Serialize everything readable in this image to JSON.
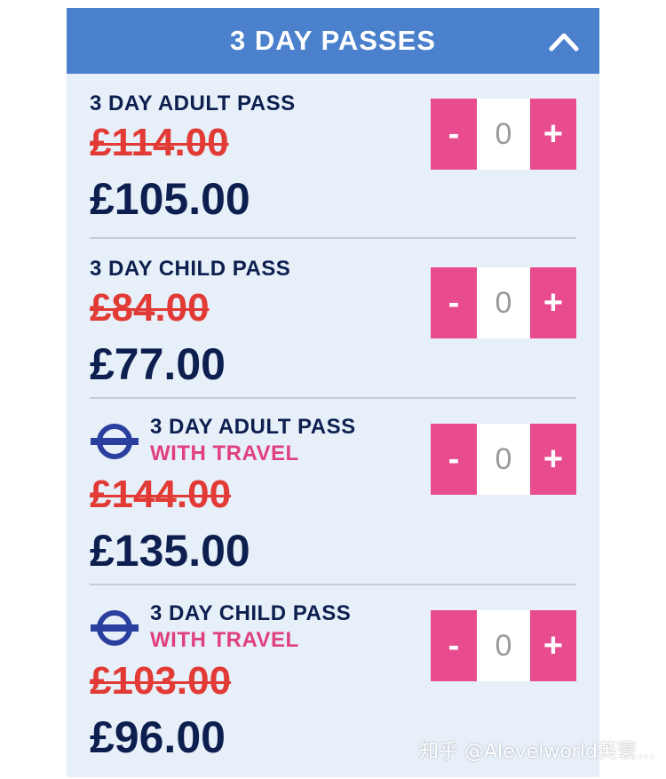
{
  "header": {
    "title": "3 DAY PASSES",
    "collapse_icon": "chevron-up-icon"
  },
  "colors": {
    "header_bg": "#4a80cc",
    "panel_bg": "#e7eff9",
    "stepper_pink": "#e94b8f",
    "old_price_red": "#e23a35",
    "navy": "#0d1f4f",
    "travel_pink": "#e0407f",
    "roundel_blue": "#2a3f9e"
  },
  "items": [
    {
      "title": "3 DAY ADULT PASS",
      "old_price": "£114.00",
      "new_price": "£105.00",
      "minus": "-",
      "quantity": "0",
      "plus": "+"
    },
    {
      "title": "3 DAY CHILD PASS",
      "old_price": "£84.00",
      "new_price": "£77.00",
      "minus": "-",
      "quantity": "0",
      "plus": "+"
    },
    {
      "title": "3 DAY ADULT PASS",
      "subtitle": "WITH TRAVEL",
      "icon": "underground-roundel-icon",
      "old_price": "£144.00",
      "new_price": "£135.00",
      "minus": "-",
      "quantity": "0",
      "plus": "+"
    },
    {
      "title": "3 DAY CHILD PASS",
      "subtitle": "WITH TRAVEL",
      "icon": "underground-roundel-icon",
      "old_price": "£103.00",
      "new_price": "£96.00",
      "minus": "-",
      "quantity": "0",
      "plus": "+"
    }
  ],
  "watermark": "知乎 @Alevelworld英寰..."
}
